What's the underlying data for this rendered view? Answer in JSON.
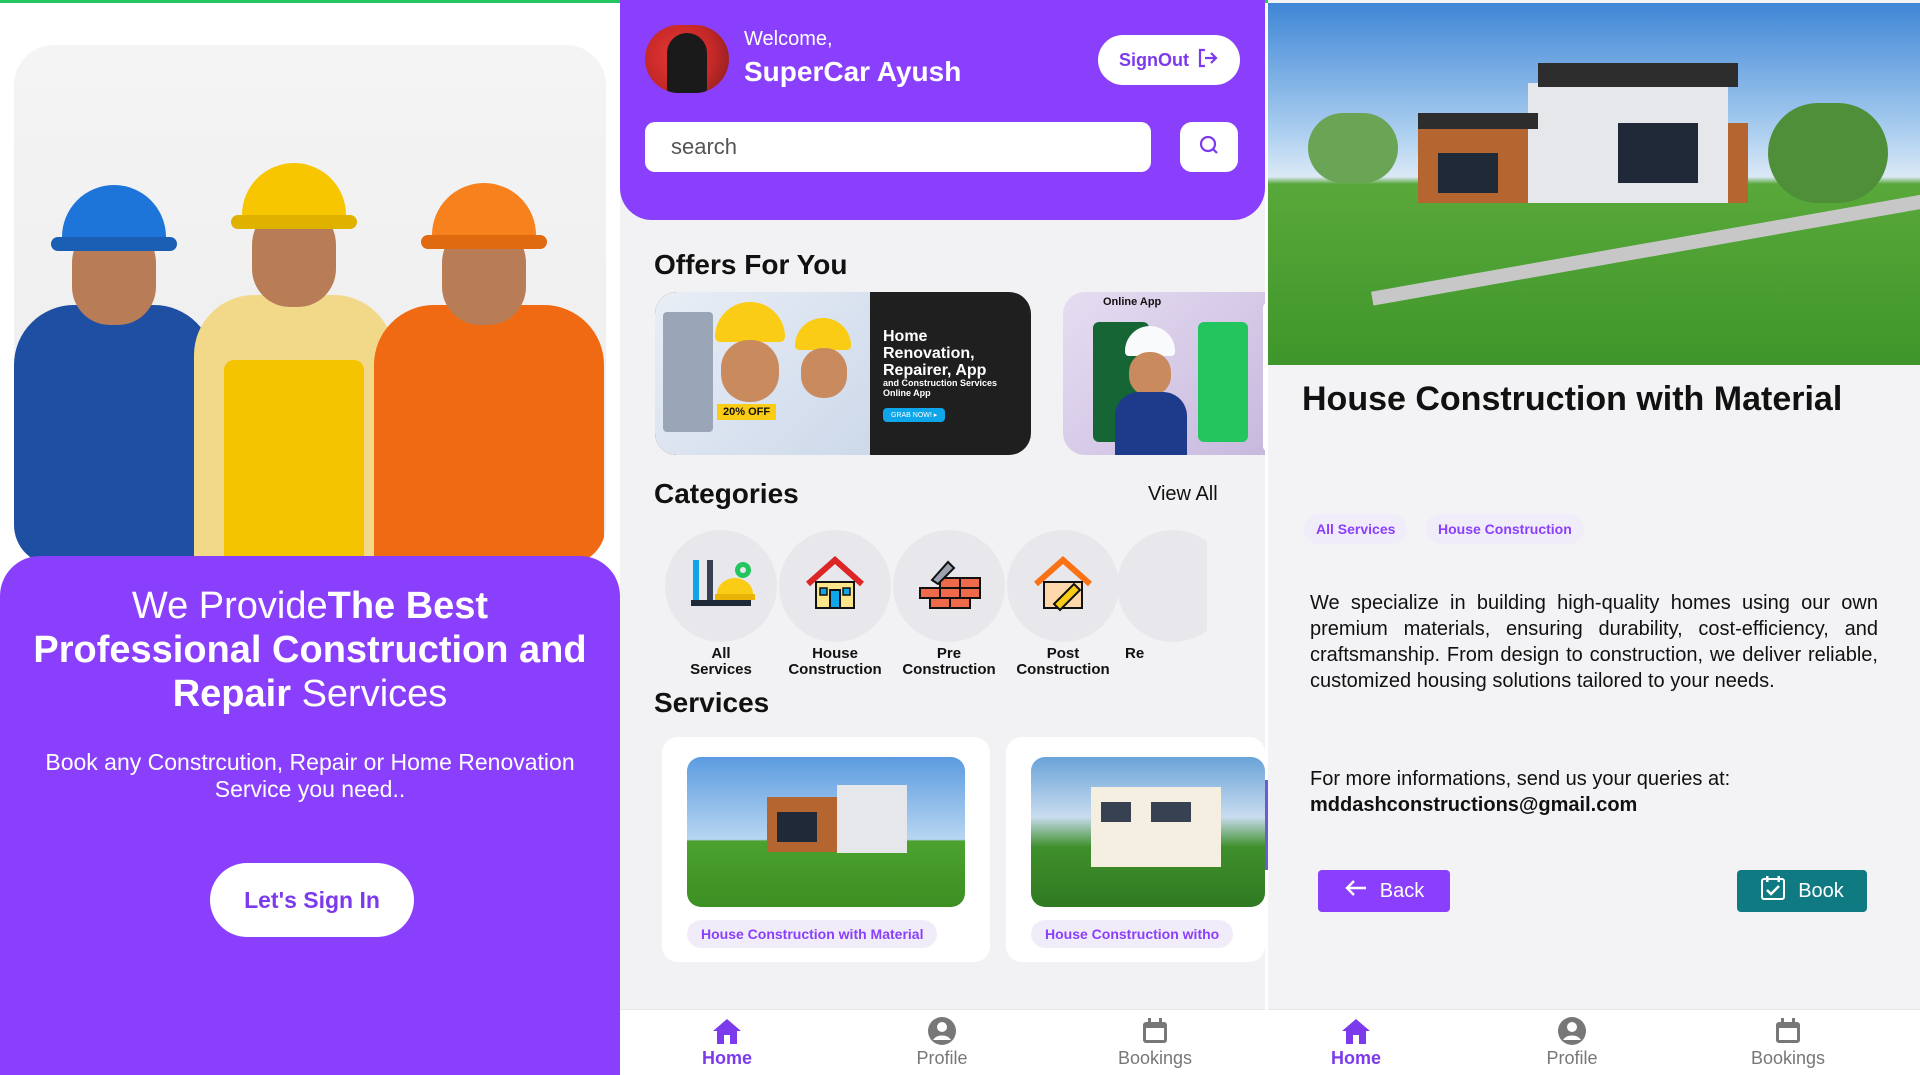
{
  "landing": {
    "heading_light": "We Provide",
    "heading_bold": "The Best Professional Construction and Repair",
    "heading_tail": "Services",
    "subtitle": "Book any Constrcution, Repair or Home Renovation Service you need..",
    "signin_button": "Let's Sign In"
  },
  "home": {
    "welcome_text": "Welcome,",
    "user_name": "SuperCar Ayush",
    "signout_label": "SignOut",
    "search_placeholder": "search",
    "offers_title": "Offers For You",
    "offers": [
      {
        "title": "Home Renovation, Repairer, App",
        "subtitle": "and Construction Services Online App",
        "badge": "20% OFF",
        "cta": "GRAB NOW! ▸"
      },
      {
        "label": "Online App"
      }
    ],
    "categories_title": "Categories",
    "view_all_label": "View All",
    "categories": [
      {
        "label_line1": "All",
        "label_line2": "Services",
        "icon": "tools-icon"
      },
      {
        "label_line1": "House",
        "label_line2": "Construction",
        "icon": "house-icon"
      },
      {
        "label_line1": "Pre",
        "label_line2": "Construction",
        "icon": "bricks-icon"
      },
      {
        "label_line1": "Post",
        "label_line2": "Construction",
        "icon": "house-repair-icon"
      },
      {
        "label_line1": "Re",
        "label_line2": "",
        "icon": "more-icon"
      }
    ],
    "services_title": "Services",
    "services": [
      {
        "name": "House Construction with Material"
      },
      {
        "name": "House Construction witho"
      }
    ]
  },
  "detail": {
    "title": "House Construction with Material",
    "tags": [
      "All Services",
      "House Construction"
    ],
    "description": "We specialize in building high-quality homes using our own premium materials, ensuring durability, cost-efficiency, and craftsmanship. From design to construction, we deliver reliable, customized housing solutions tailored to your needs.",
    "contact_text": "For more informations, send us your queries at:",
    "contact_email": "mddashconstructions@gmail.com",
    "back_label": "Back",
    "book_label": "Book"
  },
  "nav": {
    "home": "Home",
    "profile": "Profile",
    "bookings": "Bookings"
  },
  "colors": {
    "primary": "#8a3ffc",
    "teal": "#0f7a82",
    "background": "#f2f2f4"
  }
}
